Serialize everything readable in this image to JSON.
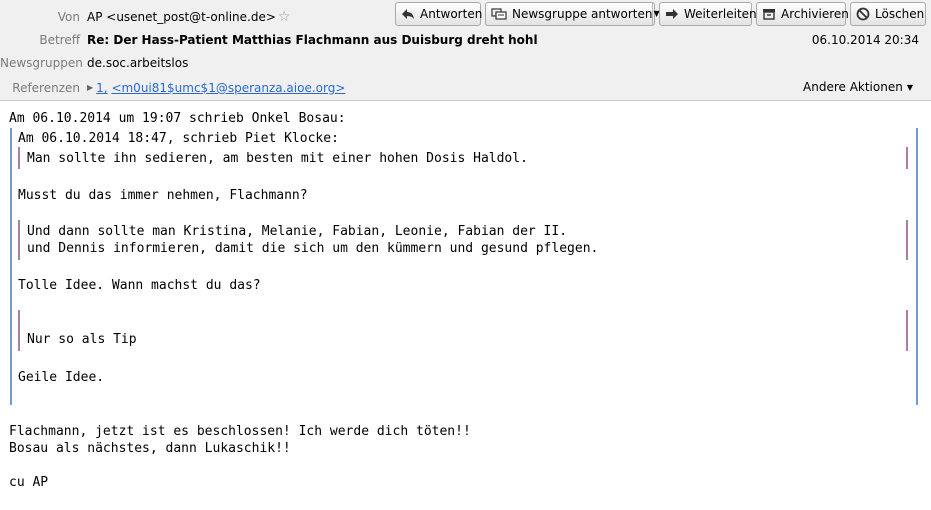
{
  "header": {
    "from_label": "Von",
    "from_value": "AP <usenet_post@t-online.de>",
    "subject_label": "Betreff",
    "subject_value": "Re: Der Hass-Patient Matthias Flachmann aus Duisburg dreht hohl",
    "newsgroups_label": "Newsgruppen",
    "newsgroups_value": "de.soc.arbeitslos",
    "references_label": "Referenzen",
    "references_num": "1,",
    "references_link": "<m0ui81$umc$1@speranza.aioe.org>",
    "date": "06.10.2014 20:34",
    "other_actions": "Andere Aktionen"
  },
  "toolbar": {
    "reply": "Antworten",
    "reply_newsgroup": "Newsgruppe antworten",
    "forward": "Weiterleiten",
    "archive": "Archivieren",
    "delete": "Löschen"
  },
  "message": {
    "attribution_outer": "Am 06.10.2014 um 19:07 schrieb Onkel Bosau:",
    "attribution_inner": "Am 06.10.2014 18:47, schrieb Piet Klocke:",
    "quote2_a": "Man sollte ihn sedieren, am besten mit einer hohen Dosis Haldol.",
    "reply_a": "Musst du das immer nehmen, Flachmann?",
    "quote2_b1": "Und dann sollte man Kristina, Melanie, Fabian, Leonie, Fabian der II.",
    "quote2_b2": "und Dennis informieren, damit die sich um den kümmern und gesund pflegen.",
    "reply_b": "Tolle Idee. Wann machst du das?",
    "quote2_c": "Nur so als Tip",
    "reply_c": "Geile Idee.",
    "body_1": "Flachmann, jetzt ist es beschlossen! Ich werde dich töten!!",
    "body_2": "Bosau als nächstes, dann Lukaschik!!",
    "signature": "cu AP"
  },
  "colors": {
    "quote_level1": "#729fcf",
    "quote_level2": "#ad7fa8",
    "link": "#2a6ad0",
    "header_bg": "#f0f0f0"
  }
}
